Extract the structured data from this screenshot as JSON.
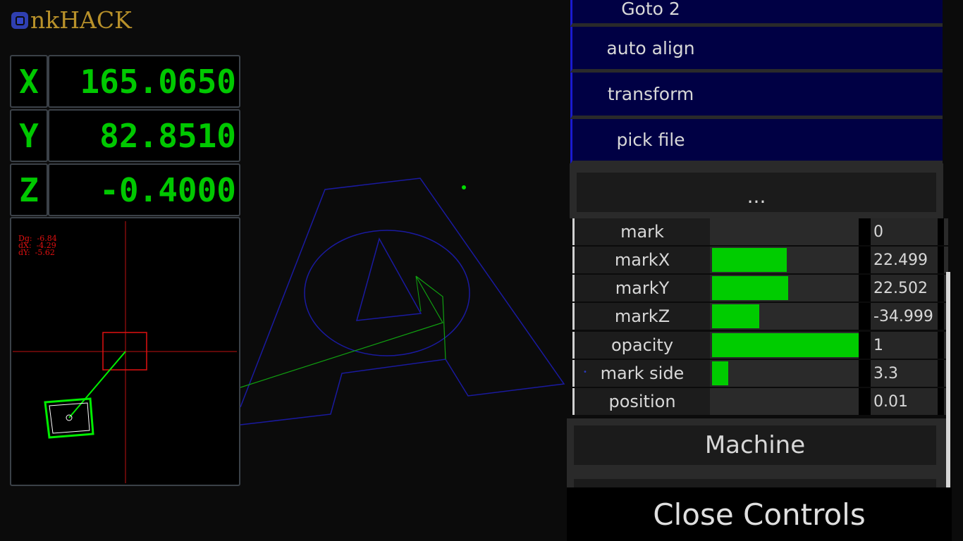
{
  "app": {
    "title": "nkHACK"
  },
  "dro": [
    {
      "axis": "X",
      "value": "165.0650"
    },
    {
      "axis": "Y",
      "value": "82.8510"
    },
    {
      "axis": "Z",
      "value": "-0.4000"
    }
  ],
  "camera": {
    "readout": [
      "Dg:  -6.84",
      "dX:  -4.29",
      "dY:  -5.62"
    ]
  },
  "menu": {
    "items": [
      "Goto 2",
      "auto align",
      "transform",
      "pick file"
    ],
    "more_label": "..."
  },
  "sliders": [
    {
      "label": "mark",
      "value": "0",
      "fill": 0
    },
    {
      "label": "markX",
      "value": "22.499",
      "fill": 0.51
    },
    {
      "label": "markY",
      "value": "22.502",
      "fill": 0.52
    },
    {
      "label": "markZ",
      "value": "-34.999",
      "fill": 0.32
    },
    {
      "label": "opacity",
      "value": "1",
      "fill": 1.0
    },
    {
      "label": "mark side",
      "value": "3.3",
      "fill": 0.11
    },
    {
      "label": "position",
      "value": "0.01",
      "fill": 0
    }
  ],
  "machine_label": "Machine",
  "close_label": "Close Controls",
  "colors": {
    "dro_text": "#00c800",
    "logo_text": "#b8912a",
    "panel_bg": "#000044",
    "slider_fill": "#00cc00",
    "readout_text": "#e01010"
  }
}
